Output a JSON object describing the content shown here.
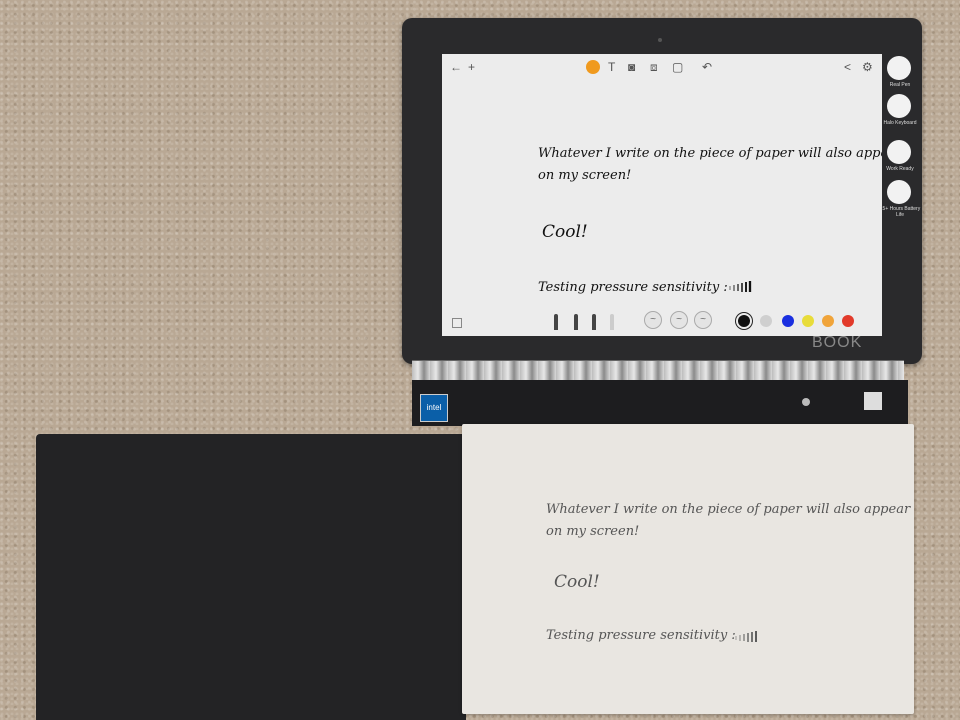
{
  "device": {
    "brand": "BOOK",
    "intel_badge": "intel"
  },
  "screen": {
    "toolbar_icons": [
      "back-arrow-icon",
      "plus-icon",
      "pen-icon",
      "text-icon",
      "camera-icon",
      "crop-icon",
      "frame-icon",
      "undo-icon",
      "share-icon",
      "settings-icon"
    ],
    "toolbar_glyphs": {
      "back": "←",
      "plus": "+",
      "text": "T",
      "camera": "◙",
      "crop": "⧈",
      "frame": "▢",
      "undo": "↶",
      "share": "<",
      "settings": "⚙"
    },
    "note": {
      "line1": "Whatever I write on the piece of paper will also appear",
      "line2": "on my screen!",
      "line3": "Cool!",
      "line4": "Testing pressure sensitivity :"
    },
    "brush_glyph": "~",
    "colors": [
      "#111111",
      "#cfcfcf",
      "#1a2fe0",
      "#e8dc3a",
      "#f0a43a",
      "#e23a2a"
    ],
    "selected_color": "#111111"
  },
  "side_panel": {
    "items": [
      {
        "label": "Real Pen",
        "icon": "pen-icon"
      },
      {
        "label": "Halo Keyboard",
        "icon": "keyboard-icon"
      },
      {
        "label": "Work Ready",
        "icon": "briefcase-icon"
      },
      {
        "label": "15+ Hours Battery Life",
        "icon": "battery-icon"
      }
    ]
  },
  "paper_pad": {
    "line1": "Whatever I write on the piece of paper will also appear",
    "line2": "on my screen!",
    "line3": "Cool!",
    "line4": "Testing pressure sensitivity :"
  }
}
